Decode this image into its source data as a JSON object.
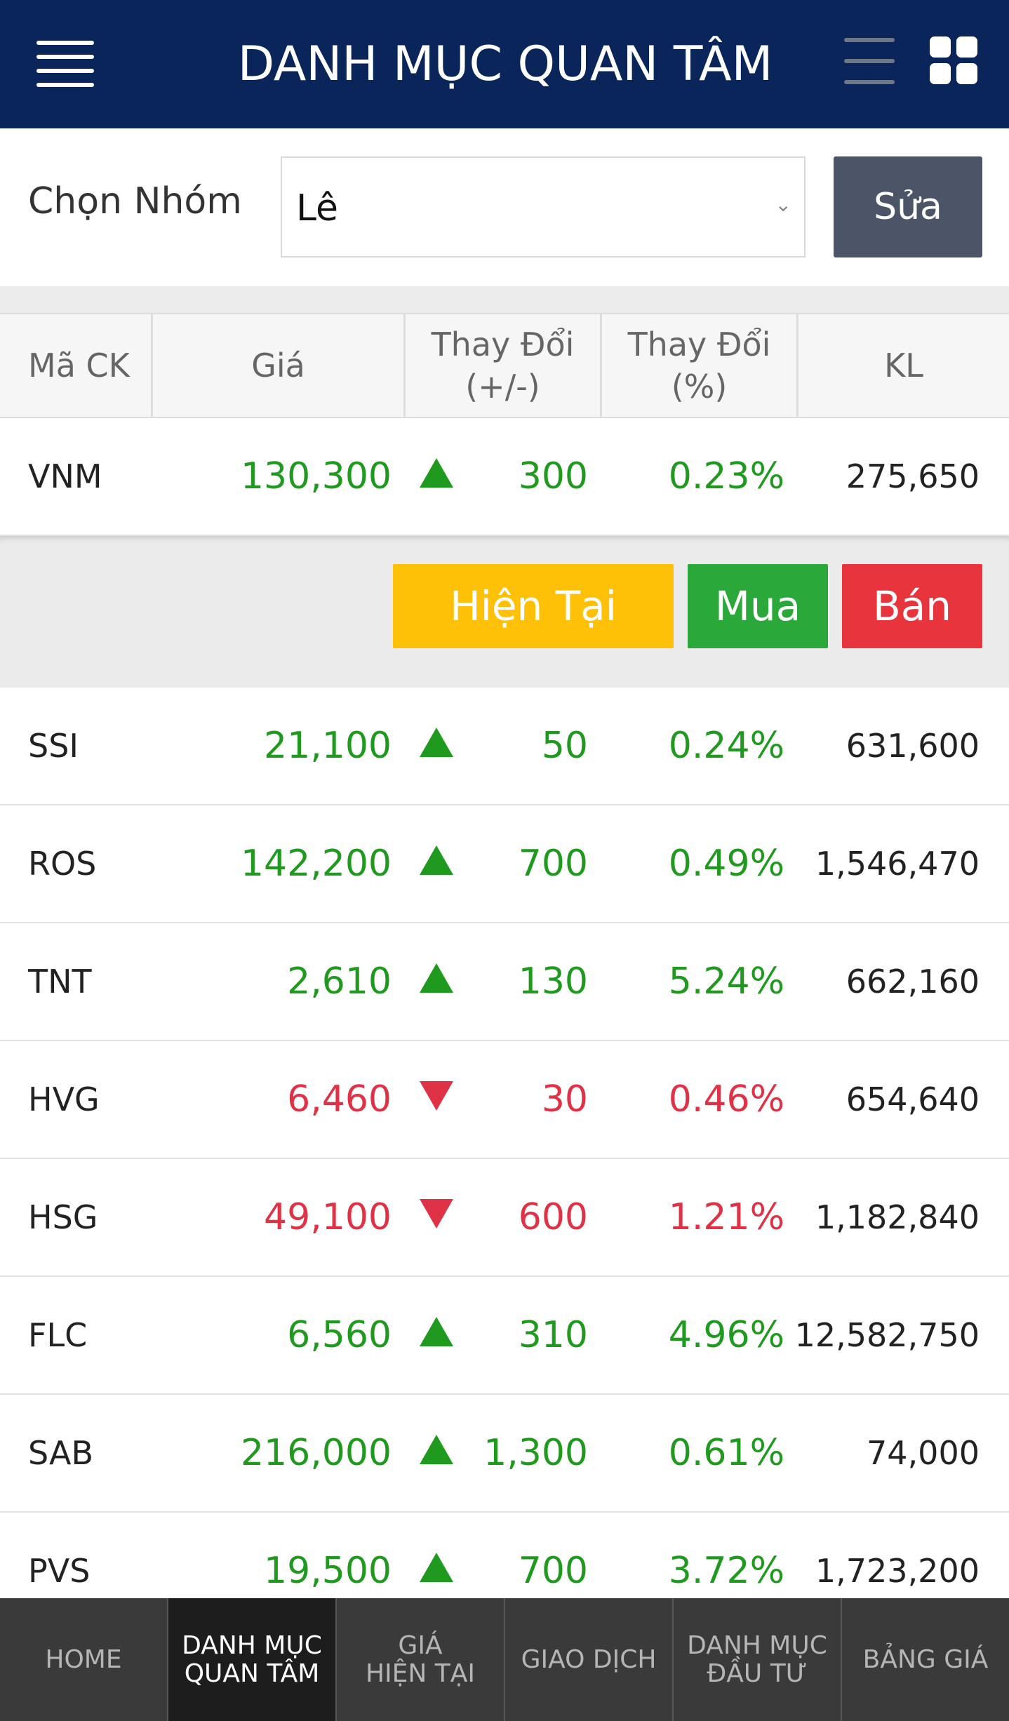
{
  "header": {
    "title": "DANH MỤC QUAN TÂM",
    "menu_icon": "hamburger-menu-icon",
    "list_icon": "list-view-icon",
    "grid_icon": "grid-view-icon"
  },
  "group": {
    "label": "Chọn Nhóm",
    "selected": "Lê",
    "edit_label": "Sửa"
  },
  "table": {
    "headers": {
      "symbol": "Mã CK",
      "price": "Giá",
      "change_line1": "Thay Đổi",
      "change_line2": "(+/-)",
      "pct_line1": "Thay Đổi",
      "pct_line2": "(%)",
      "volume": "KL"
    },
    "rows": [
      {
        "symbol": "VNM",
        "price": "130,300",
        "dir": "up",
        "change": "300",
        "pct": "0.23%",
        "volume": "275,650"
      },
      {
        "symbol": "SSI",
        "price": "21,100",
        "dir": "up",
        "change": "50",
        "pct": "0.24%",
        "volume": "631,600"
      },
      {
        "symbol": "ROS",
        "price": "142,200",
        "dir": "up",
        "change": "700",
        "pct": "0.49%",
        "volume": "1,546,470"
      },
      {
        "symbol": "TNT",
        "price": "2,610",
        "dir": "up",
        "change": "130",
        "pct": "5.24%",
        "volume": "662,160"
      },
      {
        "symbol": "HVG",
        "price": "6,460",
        "dir": "down",
        "change": "30",
        "pct": "0.46%",
        "volume": "654,640"
      },
      {
        "symbol": "HSG",
        "price": "49,100",
        "dir": "down",
        "change": "600",
        "pct": "1.21%",
        "volume": "1,182,840"
      },
      {
        "symbol": "FLC",
        "price": "6,560",
        "dir": "up",
        "change": "310",
        "pct": "4.96%",
        "volume": "12,582,750"
      },
      {
        "symbol": "SAB",
        "price": "216,000",
        "dir": "up",
        "change": "1,300",
        "pct": "0.61%",
        "volume": "74,000"
      },
      {
        "symbol": "PVS",
        "price": "19,500",
        "dir": "up",
        "change": "700",
        "pct": "3.72%",
        "volume": "1,723,200"
      }
    ]
  },
  "actions": {
    "current": "Hiện Tại",
    "buy": "Mua",
    "sell": "Bán"
  },
  "colors": {
    "header_bg": "#0a2559",
    "up": "#1f9a1f",
    "down": "#e03246",
    "current_btn": "#ffc107",
    "buy_btn": "#2aa83a",
    "sell_btn": "#e8343c"
  },
  "bottom_nav": [
    {
      "line1": "HOME",
      "line2": "",
      "active": false
    },
    {
      "line1": "DANH MỤC",
      "line2": "QUAN TÂM",
      "active": true
    },
    {
      "line1": "GIÁ",
      "line2": "HIỆN TẠI",
      "active": false
    },
    {
      "line1": "GIAO DỊCH",
      "line2": "",
      "active": false
    },
    {
      "line1": "DANH MỤC",
      "line2": "ĐẦU TƯ",
      "active": false
    },
    {
      "line1": "BẢNG GIÁ",
      "line2": "",
      "active": false
    }
  ]
}
